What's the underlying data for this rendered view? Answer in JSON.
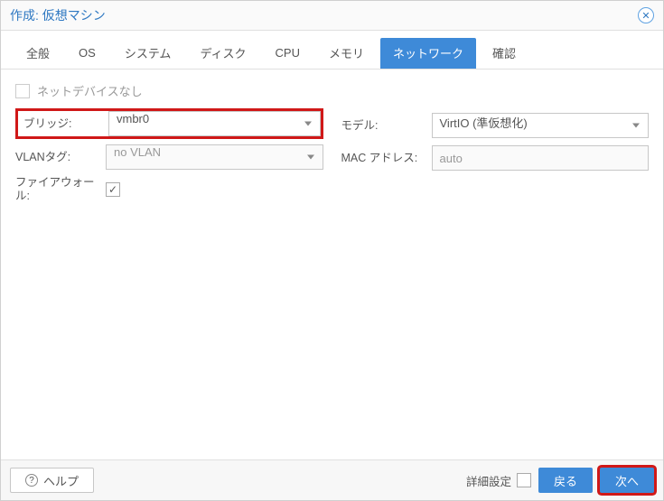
{
  "window": {
    "title": "作成: 仮想マシン"
  },
  "tabs": {
    "general": "全般",
    "os": "OS",
    "system": "システム",
    "disk": "ディスク",
    "cpu": "CPU",
    "memory": "メモリ",
    "network": "ネットワーク",
    "confirm": "確認"
  },
  "fields": {
    "no_net_device": {
      "label": "ネットデバイスなし",
      "checked": false
    },
    "bridge": {
      "label": "ブリッジ:",
      "value": "vmbr0"
    },
    "vlan_tag": {
      "label": "VLANタグ:",
      "value": "no VLAN"
    },
    "firewall": {
      "label": "ファイアウォール:",
      "checked": true
    },
    "model": {
      "label": "モデル:",
      "value": "VirtIO (準仮想化)"
    },
    "mac": {
      "label": "MAC アドレス:",
      "value": "auto"
    }
  },
  "footer": {
    "help": "ヘルプ",
    "advanced": "詳細設定",
    "back": "戻る",
    "next": "次へ"
  }
}
